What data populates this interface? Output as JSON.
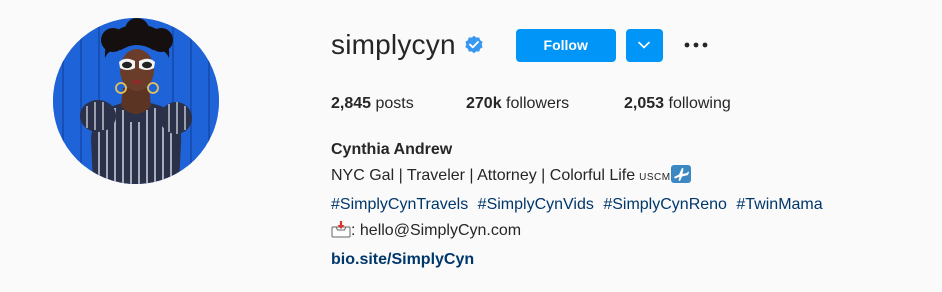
{
  "profile": {
    "username": "simplycyn",
    "verified": true,
    "follow_label": "Follow",
    "dropdown_icon": "chevron-down-icon",
    "more_icon": "more-horizontal-icon"
  },
  "stats": {
    "posts_count": "2,845",
    "posts_label": "posts",
    "followers_count": "270k",
    "followers_label": "followers",
    "following_count": "2,053",
    "following_label": "following"
  },
  "bio": {
    "full_name": "Cynthia Andrew",
    "line1": "NYC Gal | Traveler | Attorney | Colorful Life",
    "line1_suffix": "USCM",
    "line1_emoji": "airplane-icon",
    "hashtags": [
      "#SimplyCynTravels",
      "#SimplyCynVids",
      "#SimplyCynReno",
      "#TwinMama"
    ],
    "email_emoji": "inbox-tray-icon",
    "email_line": ": hello@SimplyCyn.com",
    "link": "bio.site/SimplyCyn"
  },
  "colors": {
    "accent": "#0095f6",
    "text": "#262626",
    "link": "#00376b",
    "background": "#fafafa",
    "verified_badge": "#3897f0"
  }
}
